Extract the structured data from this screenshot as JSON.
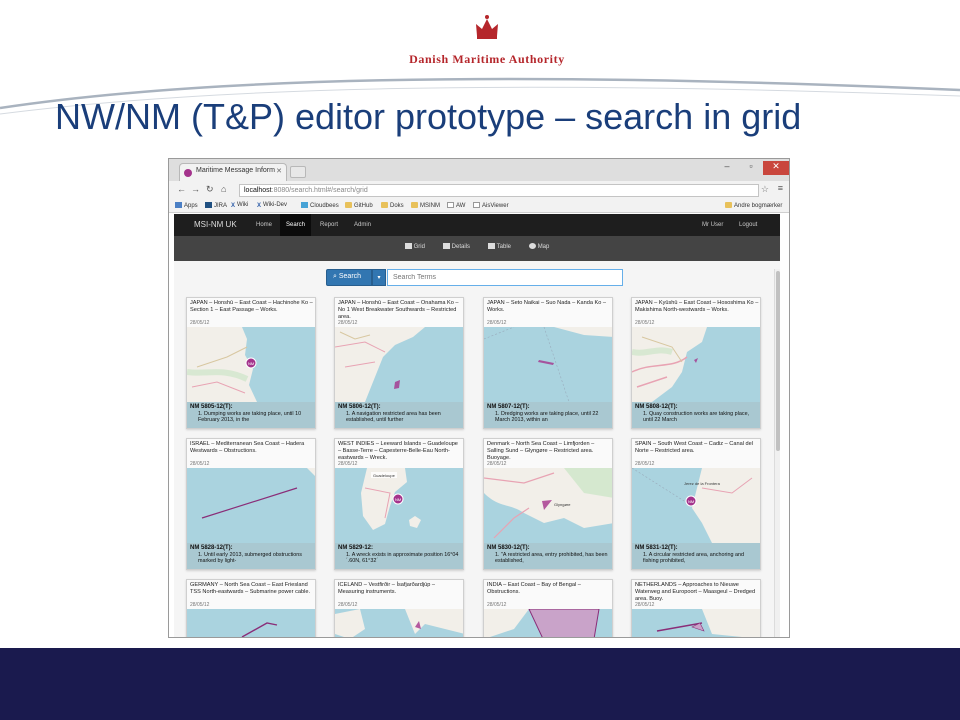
{
  "slide": {
    "org_name": "Danish Maritime Authority",
    "title": "NW/NM (T&P) editor prototype – search in grid"
  },
  "browser": {
    "tab_title": "Maritime Message Inform",
    "url_host": "localhost",
    "url_rest": ":8080/search.html#/search/grid",
    "bookmarks": [
      "Apps",
      "JIRA",
      "Wiki",
      "Wiki-Dev",
      "Cloudbees",
      "GitHub",
      "Doks",
      "MSINM",
      "AW",
      "AisViewer"
    ],
    "other_bookmarks": "Andre bogmærker"
  },
  "app": {
    "brand": "MSI-NM UK",
    "nav": [
      "Home",
      "Search",
      "Report",
      "Admin"
    ],
    "active_nav": "Search",
    "user_nav": [
      "Mr User",
      "Logout"
    ],
    "views": [
      "Grid",
      "Details",
      "Table",
      "Map"
    ],
    "active_view": "Grid",
    "search_button": "Search",
    "search_placeholder": "Search Terms"
  },
  "messages": [
    {
      "title": "JAPAN – Honshū – East Coast – Hachinohe Ko – Section 1 – East Passage – Works.",
      "date": "28/05/12",
      "id": "NM 5805-12(T):",
      "desc": "1.  Dumping works are taking place, until 10 February 2013, in the",
      "marker": true
    },
    {
      "title": "JAPAN – Honshū – East Coast – Onahama Ko – No 1 West Breakwater Southwards – Restricted area.",
      "date": "28/05/12",
      "id": "NM 5806-12(T):",
      "desc": "1.  A navigation restricted area has been established, until further",
      "marker": false
    },
    {
      "title": "JAPAN – Seto Naikai – Suo Nada – Kanda Ko – Works.",
      "date": "28/05/12",
      "id": "NM 5807-12(T):",
      "desc": "1.  Dredging works are taking place, until 22 March 2013, within an",
      "marker": false
    },
    {
      "title": "JAPAN – Kyūshū – East Coast – Hososhima Ko – Makishima North-westwards – Works.",
      "date": "28/05/12",
      "id": "NM 5808-12(T):",
      "desc": "1.  Quay construction works are taking place, until 22 March",
      "marker": false
    },
    {
      "title": "ISRAEL – Mediterranean Sea Coast – Hadera Westwards – Obstructions.",
      "date": "28/05/12",
      "id": "NM 5828-12(T):",
      "desc": "1.  Until early 2013, submerged obstructions marked by light-",
      "marker": false
    },
    {
      "title": "WEST INDIES – Leeward Islands – Guadeloupe – Basse-Terre – Capesterre-Belle-Eau North-eastwards – Wreck.",
      "date": "28/05/12",
      "id": "NM 5829-12:",
      "desc": "1.  A wreck exists in approximate position 16°04´.60N, 61°32´",
      "marker": true,
      "place": "Guadeloupe"
    },
    {
      "title": "Denmark – North Sea Coast – Limfjorden – Salling Sund – Glyngøre – Restricted area. Buoyage.",
      "date": "28/05/12",
      "id": "NM 5830-12(T):",
      "desc": "1.  \"A restricted area, entry prohibited, has been established,",
      "marker": false,
      "place": "Glyngøre"
    },
    {
      "title": "SPAIN – South West Coast – Cadiz – Canal del Norte – Restricted area.",
      "date": "28/05/12",
      "id": "NM 5831-12(T):",
      "desc": "1.  A circular restricted area, anchoring and fishing prohibited,",
      "marker": true,
      "place": "Jerez de la Frontera"
    },
    {
      "title": "GERMANY – North Sea Coast – East Friesland TSS North-eastwards – Submarine power cable.",
      "date": "28/05/12",
      "id": "",
      "desc": "",
      "marker": false
    },
    {
      "title": "ICELAND – Vestfirðir – Ísafjarðardjúp – Measuring instruments.",
      "date": "28/05/12",
      "id": "",
      "desc": "",
      "marker": false
    },
    {
      "title": "INDIA – East Coast – Bay of Bengal – Obstructions.",
      "date": "28/05/12",
      "id": "",
      "desc": "",
      "marker": false
    },
    {
      "title": "NETHERLANDS – Approaches to Nieuwe Waterweg and Europoort – Maasgeul – Dredged area. Buoy.",
      "date": "28/05/12",
      "id": "",
      "desc": "",
      "marker": false
    }
  ],
  "colors": {
    "title_blue": "#1a3e7a",
    "logo_red": "#b5262b",
    "footer_navy": "#1a1a4e",
    "marker_purple": "#a4338c",
    "sea": "#aad3df",
    "land": "#f2efe9"
  }
}
